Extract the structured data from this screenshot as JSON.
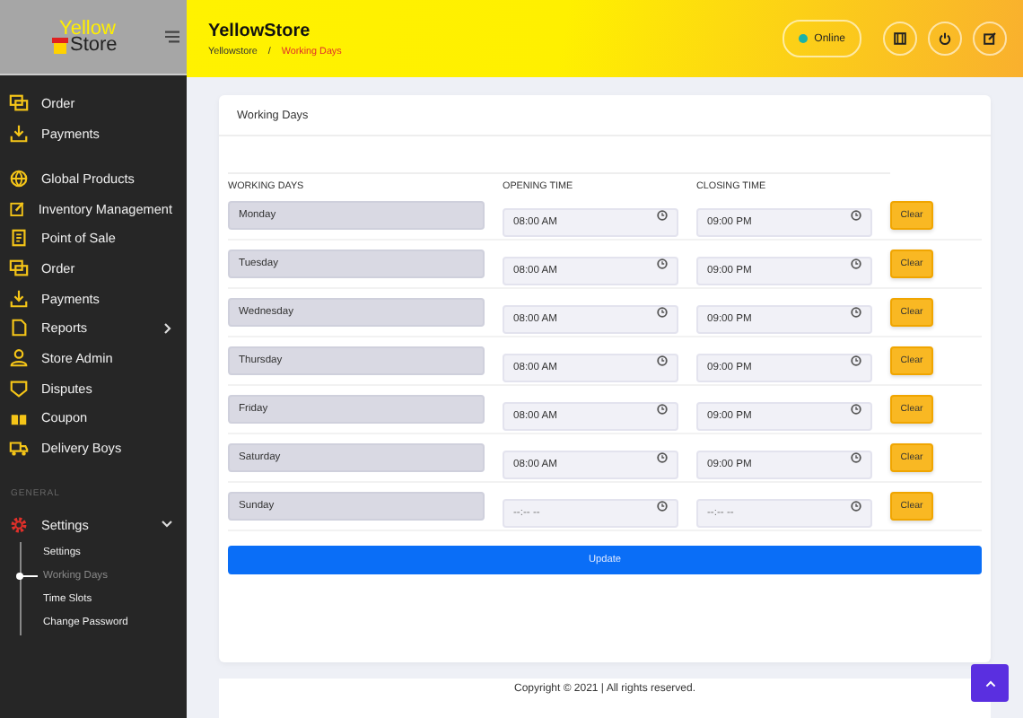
{
  "sidebar": {
    "logo": {
      "top": "Yellow",
      "bottom": "Store"
    },
    "scrolled_items": [
      {
        "label": "Order",
        "expandable": false
      },
      {
        "label": "Payments",
        "expandable": false
      }
    ],
    "items": [
      {
        "label": "Global Products",
        "expandable": false
      },
      {
        "label": "Inventory Management",
        "expandable": false
      },
      {
        "label": "Point of Sale",
        "expandable": false
      },
      {
        "label": "Order",
        "expandable": false
      },
      {
        "label": "Payments",
        "expandable": false
      },
      {
        "label": "Reports",
        "expandable": true
      },
      {
        "label": "Store Admin",
        "expandable": false
      },
      {
        "label": "Disputes",
        "expandable": false
      },
      {
        "label": "Coupon",
        "expandable": false
      },
      {
        "label": "Delivery Boys",
        "expandable": false
      }
    ],
    "section": "GENERAL",
    "settings": {
      "label": "Settings",
      "expanded": true,
      "children": [
        {
          "label": "Settings",
          "selected": false
        },
        {
          "label": "Working Days",
          "selected": true
        },
        {
          "label": "Time Slots",
          "selected": false
        },
        {
          "label": "Change Password",
          "selected": false
        }
      ]
    }
  },
  "header": {
    "title": "YellowStore",
    "breadcrumb": [
      "Yellowstore",
      "Working Days"
    ],
    "breadcrumb_separator": "/",
    "status": "Online"
  },
  "card": {
    "title": "Working Days",
    "columns": [
      "WORKING DAYS",
      "OPENING TIME",
      "CLOSING TIME"
    ],
    "rows": [
      {
        "day": "Monday",
        "opening": {
          "value": "08:00 AM"
        },
        "closing": {
          "value": "09:00 PM"
        },
        "button": "Clear"
      },
      {
        "day": "Tuesday",
        "opening": {
          "value": "08:00 AM"
        },
        "closing": {
          "value": "09:00 PM"
        },
        "button": "Clear"
      },
      {
        "day": "Wednesday",
        "opening": {
          "value": "08:00 AM"
        },
        "closing": {
          "value": "09:00 PM"
        },
        "button": "Clear"
      },
      {
        "day": "Thursday",
        "opening": {
          "value": "08:00 AM"
        },
        "closing": {
          "value": "09:00 PM"
        },
        "button": "Clear"
      },
      {
        "day": "Friday",
        "opening": {
          "value": "08:00 AM"
        },
        "closing": {
          "value": "09:00 PM"
        },
        "button": "Clear"
      },
      {
        "day": "Saturday",
        "opening": {
          "value": "08:00 AM"
        },
        "closing": {
          "value": "09:00 PM"
        },
        "button": "Clear"
      },
      {
        "day": "Sunday",
        "opening": {
          "placeholder": "--:-- --"
        },
        "closing": {
          "placeholder": "--:-- --"
        },
        "button": "Clear"
      }
    ],
    "submit": "Update"
  },
  "footer": "Copyright © 2021 | All rights reserved."
}
